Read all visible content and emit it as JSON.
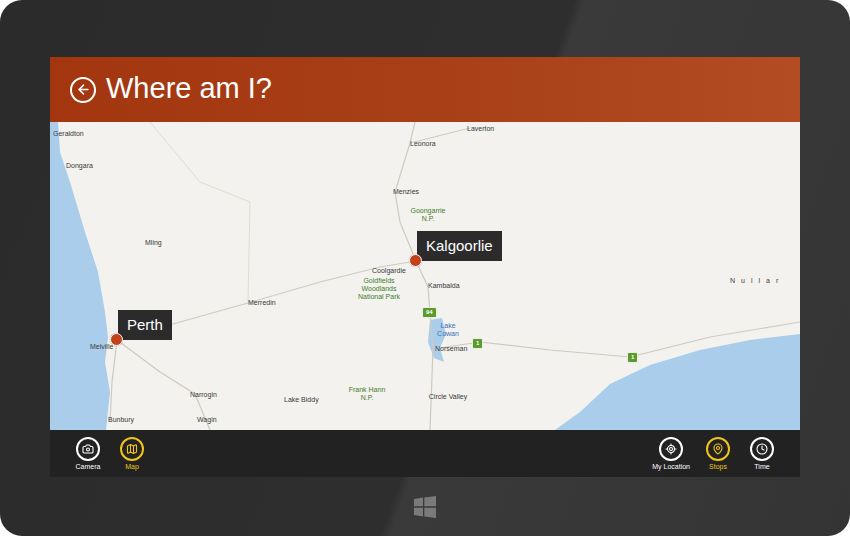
{
  "header": {
    "title": "Where am I?"
  },
  "map": {
    "places": [
      {
        "name": "Geraldton",
        "kind": "town"
      },
      {
        "name": "Laverton",
        "kind": "town"
      },
      {
        "name": "Leonora",
        "kind": "town"
      },
      {
        "name": "Dongara",
        "kind": "town"
      },
      {
        "name": "Menzies",
        "kind": "town"
      },
      {
        "name": "Goongarrie N.P.",
        "kind": "park"
      },
      {
        "name": "Mling",
        "kind": "town"
      },
      {
        "name": "Coolgardie",
        "kind": "town"
      },
      {
        "name": "Kambalda",
        "kind": "town"
      },
      {
        "name": "Goldfields Woodlands National Park",
        "kind": "park"
      },
      {
        "name": "Merredin",
        "kind": "town"
      },
      {
        "name": "94",
        "kind": "road"
      },
      {
        "name": "Lake Cowan",
        "kind": "water"
      },
      {
        "name": "1",
        "kind": "road"
      },
      {
        "name": "Norseman",
        "kind": "town"
      },
      {
        "name": "1",
        "kind": "road"
      },
      {
        "name": "Nullar",
        "kind": "region"
      },
      {
        "name": "Melville",
        "kind": "town"
      },
      {
        "name": "Narrogin",
        "kind": "town"
      },
      {
        "name": "Lake Biddy",
        "kind": "town"
      },
      {
        "name": "Frank Hann N.P.",
        "kind": "park"
      },
      {
        "name": "Circle Valley",
        "kind": "town"
      },
      {
        "name": "Bunbury",
        "kind": "town"
      },
      {
        "name": "Wagin",
        "kind": "town"
      }
    ],
    "pins": [
      {
        "label": "Kalgoorlie"
      },
      {
        "label": "Perth"
      }
    ]
  },
  "app_bar": {
    "left": [
      {
        "label": "Camera",
        "selected": false
      },
      {
        "label": "Map",
        "selected": true
      }
    ],
    "right": [
      {
        "label": "My Location",
        "selected": false
      },
      {
        "label": "Stops",
        "selected": true
      },
      {
        "label": "Time",
        "selected": false
      }
    ]
  }
}
